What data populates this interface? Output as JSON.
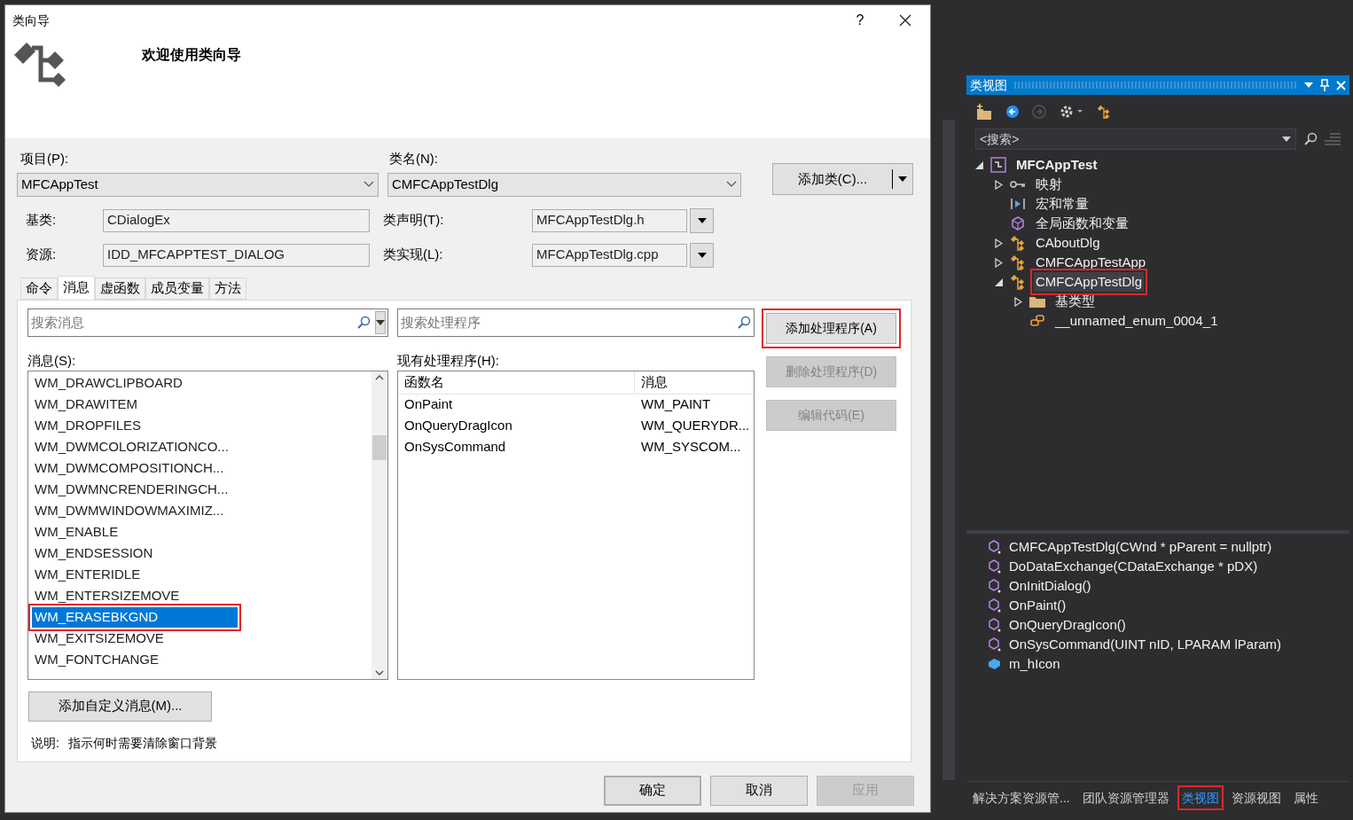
{
  "dialog": {
    "title": "类向导",
    "help_button": "?",
    "heading": "欢迎使用类向导",
    "project": {
      "label": "项目(P):",
      "value": "MFCAppTest"
    },
    "class_name": {
      "label": "类名(N):",
      "value": "CMFCAppTestDlg"
    },
    "add_class_button": "添加类(C)...",
    "base_class": {
      "label": "基类:",
      "value": "CDialogEx"
    },
    "resource": {
      "label": "资源:",
      "value": "IDD_MFCAPPTEST_DIALOG"
    },
    "class_declaration": {
      "label": "类声明(T):",
      "value": "MFCAppTestDlg.h"
    },
    "class_implementation": {
      "label": "类实现(L):",
      "value": "MFCAppTestDlg.cpp"
    },
    "tabs": [
      {
        "label": "命令",
        "selected": false
      },
      {
        "label": "消息",
        "selected": true
      },
      {
        "label": "虚函数",
        "selected": false
      },
      {
        "label": "成员变量",
        "selected": false
      },
      {
        "label": "方法",
        "selected": false
      }
    ],
    "message_search": {
      "placeholder": "搜索消息"
    },
    "handler_search": {
      "placeholder": "搜索处理程序"
    },
    "messages_label": "消息(S):",
    "messages": [
      {
        "text": "WM_DRAWCLIPBOARD",
        "selected": false,
        "annotated": false
      },
      {
        "text": "WM_DRAWITEM",
        "selected": false,
        "annotated": false
      },
      {
        "text": "WM_DROPFILES",
        "selected": false,
        "annotated": false
      },
      {
        "text": "WM_DWMCOLORIZATIONCO...",
        "selected": false,
        "annotated": false
      },
      {
        "text": "WM_DWMCOMPOSITIONCH...",
        "selected": false,
        "annotated": false
      },
      {
        "text": "WM_DWMNCRENDERINGCH...",
        "selected": false,
        "annotated": false
      },
      {
        "text": "WM_DWMWINDOWMAXIMIZ...",
        "selected": false,
        "annotated": false
      },
      {
        "text": "WM_ENABLE",
        "selected": false,
        "annotated": false
      },
      {
        "text": "WM_ENDSESSION",
        "selected": false,
        "annotated": false
      },
      {
        "text": "WM_ENTERIDLE",
        "selected": false,
        "annotated": false
      },
      {
        "text": "WM_ENTERSIZEMOVE",
        "selected": false,
        "annotated": false
      },
      {
        "text": "WM_ERASEBKGND",
        "selected": true,
        "annotated": true
      },
      {
        "text": "WM_EXITSIZEMOVE",
        "selected": false,
        "annotated": false
      },
      {
        "text": "WM_FONTCHANGE",
        "selected": false,
        "annotated": false
      }
    ],
    "handlers_label": "现有处理程序(H):",
    "handlers": {
      "columns": [
        "函数名",
        "消息"
      ],
      "rows": [
        [
          "OnPaint",
          "WM_PAINT"
        ],
        [
          "OnQueryDragIcon",
          "WM_QUERYDR..."
        ],
        [
          "OnSysCommand",
          "WM_SYSCOM..."
        ]
      ]
    },
    "side_buttons": [
      {
        "label": "添加处理程序(A)",
        "disabled": false,
        "annotated": true
      },
      {
        "label": "删除处理程序(D)",
        "disabled": true,
        "annotated": false
      },
      {
        "label": "编辑代码(E)",
        "disabled": true,
        "annotated": false
      }
    ],
    "add_custom_message_button": "添加自定义消息(M)...",
    "description": {
      "label": "说明:",
      "text": "指示何时需要清除窗口背景"
    },
    "footer_buttons": [
      {
        "label": "确定",
        "disabled": false,
        "default": true
      },
      {
        "label": "取消",
        "disabled": false,
        "default": false
      },
      {
        "label": "应用",
        "disabled": true,
        "default": false
      }
    ]
  },
  "class_view": {
    "title": "类视图",
    "search": {
      "placeholder": "<搜索>"
    },
    "tree": [
      {
        "label": "MFCAppTest",
        "kind": "project",
        "expanded": true,
        "selected": false,
        "annotated": false,
        "children": [
          {
            "label": "映射",
            "kind": "map",
            "expanded": false,
            "selected": false,
            "annotated": false
          },
          {
            "label": "宏和常量",
            "kind": "macro",
            "selected": false,
            "annotated": false
          },
          {
            "label": "全局函数和变量",
            "kind": "global",
            "selected": false,
            "annotated": false
          },
          {
            "label": "CAboutDlg",
            "kind": "class",
            "expanded": false,
            "selected": false,
            "annotated": false
          },
          {
            "label": "CMFCAppTestApp",
            "kind": "class",
            "expanded": false,
            "selected": false,
            "annotated": false
          },
          {
            "label": "CMFCAppTestDlg",
            "kind": "class",
            "expanded": true,
            "selected": true,
            "annotated": true,
            "children": [
              {
                "label": "基类型",
                "kind": "folder",
                "expanded": false,
                "selected": false,
                "annotated": false
              },
              {
                "label": "__unnamed_enum_0004_1",
                "kind": "enum",
                "selected": false,
                "annotated": false
              }
            ]
          }
        ]
      }
    ],
    "members": [
      {
        "label": "CMFCAppTestDlg(CWnd * pParent = nullptr)",
        "kind": "method"
      },
      {
        "label": "DoDataExchange(CDataExchange * pDX)",
        "kind": "method"
      },
      {
        "label": "OnInitDialog()",
        "kind": "method"
      },
      {
        "label": "OnPaint()",
        "kind": "method"
      },
      {
        "label": "OnQueryDragIcon()",
        "kind": "method"
      },
      {
        "label": "OnSysCommand(UINT nID, LPARAM lParam)",
        "kind": "method"
      },
      {
        "label": "m_hIcon",
        "kind": "field"
      }
    ],
    "bottom_tabs": [
      {
        "label": "解决方案资源管...",
        "selected": false,
        "annotated": false
      },
      {
        "label": "团队资源管理器",
        "selected": false,
        "annotated": false
      },
      {
        "label": "类视图",
        "selected": true,
        "annotated": true
      },
      {
        "label": "资源视图",
        "selected": false,
        "annotated": false
      },
      {
        "label": "属性",
        "selected": false,
        "annotated": false
      }
    ]
  }
}
